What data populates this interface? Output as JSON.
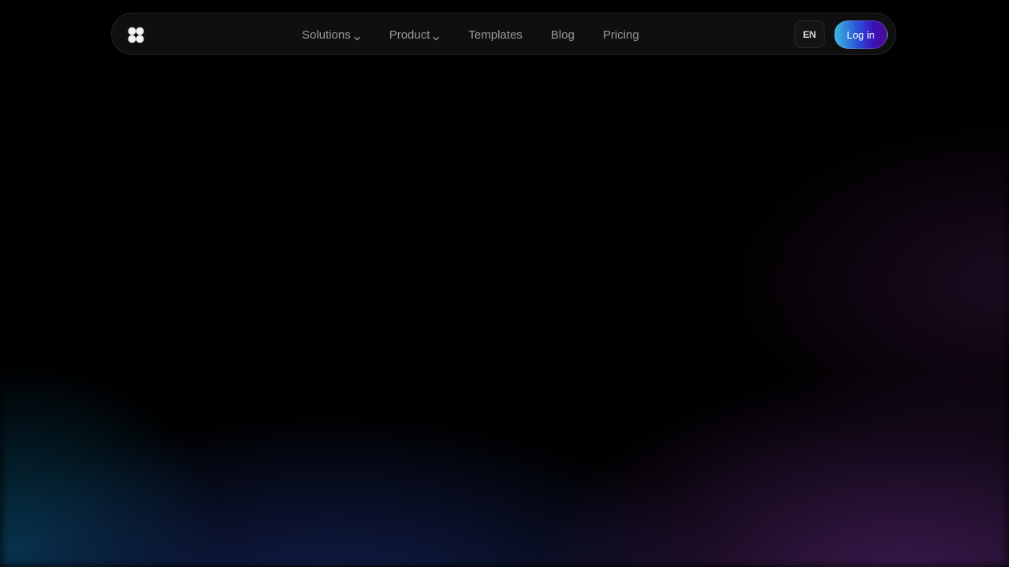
{
  "navbar": {
    "logo_icon": "clover-logo-icon",
    "links": [
      {
        "label": "Solutions",
        "has_dropdown": true
      },
      {
        "label": "Product",
        "has_dropdown": true
      },
      {
        "label": "Templates",
        "has_dropdown": false
      },
      {
        "label": "Blog",
        "has_dropdown": false
      },
      {
        "label": "Pricing",
        "has_dropdown": false
      }
    ],
    "language_label": "EN",
    "login_label": "Log in"
  },
  "colors": {
    "background": "#000000",
    "nav_background": "#0f0f10",
    "nav_text": "#9a9a9e",
    "login_gradient_start": "#38b7e0",
    "login_gradient_end": "#4b0a8e"
  }
}
